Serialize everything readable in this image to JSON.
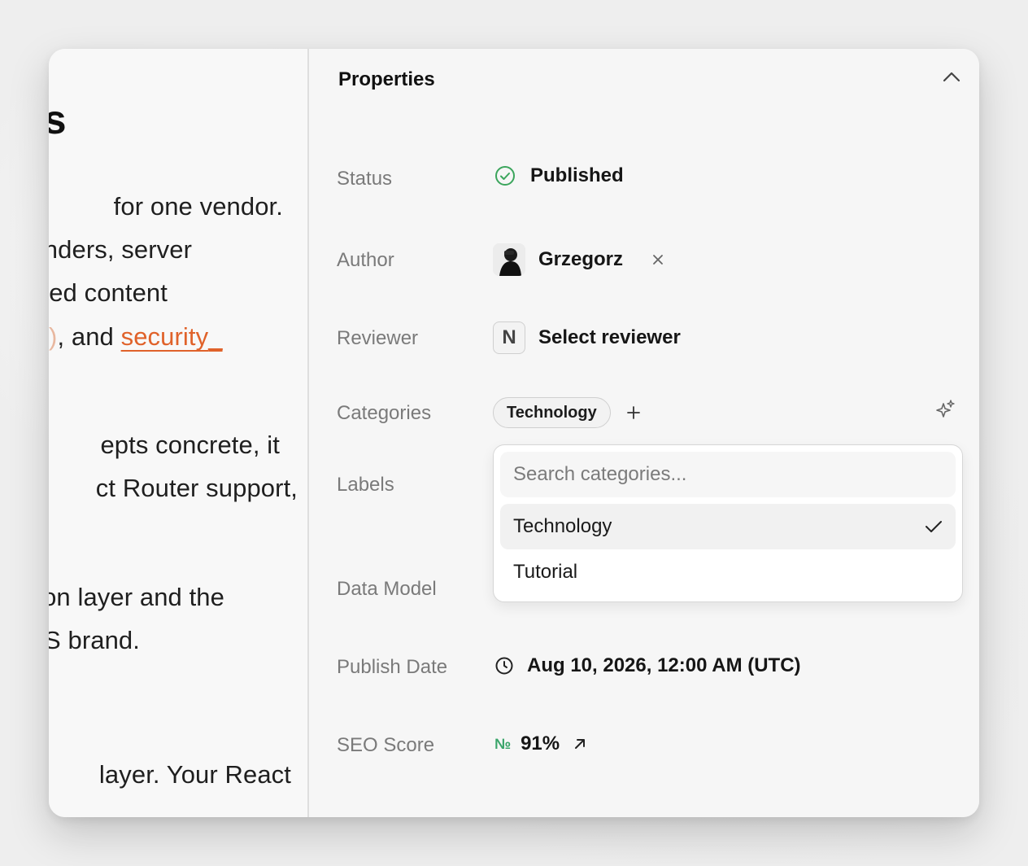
{
  "article": {
    "heading": "ks",
    "lines": [
      "for one vendor.",
      "nders, server",
      "ed content",
      "epts concrete, it",
      "ct Router support,",
      "on layer and the",
      "S brand.",
      "layer. Your React"
    ],
    "line4_prefix": ", and ",
    "line4_link": "security",
    "line4_suffix": "_"
  },
  "properties": {
    "title": "Properties",
    "status": {
      "label": "Status",
      "value": "Published",
      "color": "#3ba55c",
      "icon": "check-circle-icon"
    },
    "author": {
      "label": "Author",
      "value": "Grzegorz"
    },
    "reviewer": {
      "label": "Reviewer",
      "badge": "N",
      "value": "Select reviewer"
    },
    "categories": {
      "label": "Categories",
      "chip": "Technology"
    },
    "labels": {
      "label": "Labels"
    },
    "data_model": {
      "label": "Data Model"
    },
    "publish_date": {
      "label": "Publish Date",
      "value": "Aug 10, 2026, 12:00 AM (UTC)"
    },
    "seo_score": {
      "label": "SEO Score",
      "prefix": "№",
      "value": "91%",
      "accent": "#3aa56a"
    }
  },
  "dropdown": {
    "placeholder": "Search categories...",
    "options": [
      {
        "label": "Technology",
        "selected": true
      },
      {
        "label": "Tutorial",
        "selected": false
      }
    ]
  },
  "colors": {
    "link": "#e0622a",
    "panel": "#f6f6f6"
  }
}
